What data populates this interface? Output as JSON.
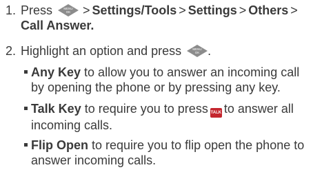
{
  "steps": [
    {
      "number": "1.",
      "text_press": "Press",
      "path": [
        "Settings/Tools",
        "Settings",
        "Others",
        "Call Answer."
      ],
      "separator": ">"
    },
    {
      "number": "2.",
      "text": "Highlight an option and press",
      "end": "."
    }
  ],
  "options": [
    {
      "name": "Any Key",
      "line1": "to allow you to answer an incoming call",
      "line2": "by opening the phone or by pressing any key."
    },
    {
      "name": "Talk Key",
      "line1_before": "to require you to press",
      "line1_after": "to answer all",
      "line2": "incoming calls."
    },
    {
      "name": "Flip Open",
      "line1": "to require you to flip open the phone to",
      "line2": "answer incoming calls."
    }
  ],
  "icons": {
    "menu_key": {
      "top_label": "MENU",
      "bottom_label": "OK",
      "color": "#8c8c8c"
    },
    "talk_key": {
      "label": "TALK",
      "color": "#c4262e"
    }
  }
}
